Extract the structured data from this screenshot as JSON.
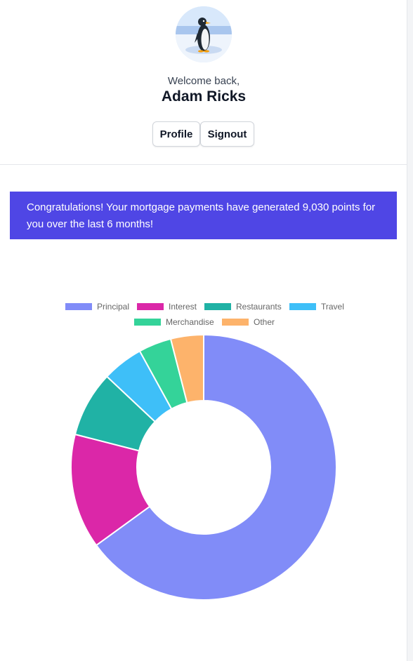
{
  "user": {
    "greeting": "Welcome back,",
    "name": "Adam Ricks"
  },
  "buttons": {
    "profile": "Profile",
    "signout": "Signout"
  },
  "banner": {
    "message": "Congratulations! Your mortgage payments have generated 9,030 points for you over the last 6 months!"
  },
  "chart_data": {
    "type": "pie",
    "style": "doughnut",
    "legend_position": "top",
    "series": [
      {
        "name": "Principal",
        "value": 65.0,
        "color": "#818cf8"
      },
      {
        "name": "Interest",
        "value": 14.0,
        "color": "#db27a8"
      },
      {
        "name": "Restaurants",
        "value": 8.0,
        "color": "#20b2a5"
      },
      {
        "name": "Travel",
        "value": 5.0,
        "color": "#3ebff8"
      },
      {
        "name": "Merchandise",
        "value": 4.0,
        "color": "#34d399"
      },
      {
        "name": "Other",
        "value": 4.0,
        "color": "#fdb36b"
      }
    ]
  }
}
